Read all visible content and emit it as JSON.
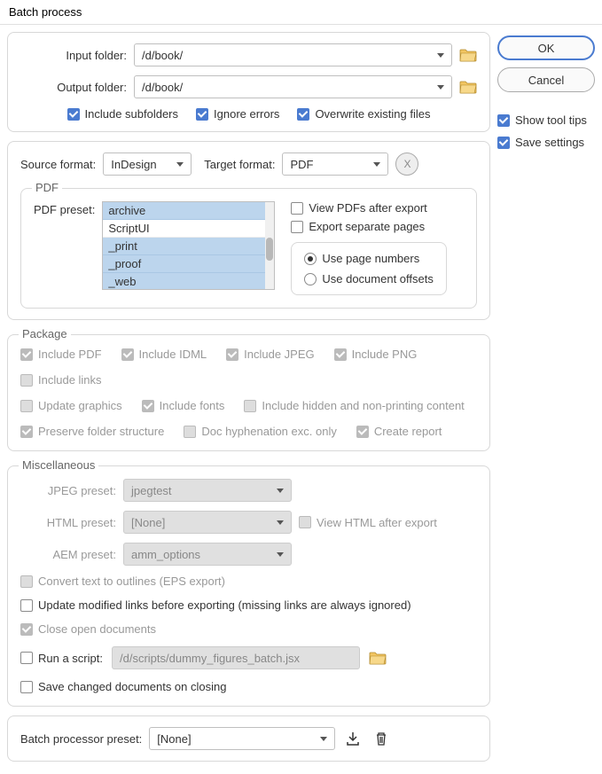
{
  "title": "Batch process",
  "buttons": {
    "ok": "OK",
    "cancel": "Cancel",
    "x": "X"
  },
  "side": {
    "tooltips": "Show tool tips",
    "save": "Save settings"
  },
  "io": {
    "input_label": "Input folder:",
    "input_value": "/d/book/",
    "output_label": "Output folder:",
    "output_value": "/d/book/",
    "subfolders": "Include subfolders",
    "ignore": "Ignore errors",
    "overwrite": "Overwrite existing files"
  },
  "format": {
    "source_label": "Source format:",
    "source_value": "InDesign",
    "target_label": "Target format:",
    "target_value": "PDF"
  },
  "pdf": {
    "legend": "PDF",
    "preset_label": "PDF preset:",
    "items": {
      "a": "archive",
      "b": "ScriptUI",
      "c": "_print",
      "d": "_proof",
      "e": "_web"
    },
    "view": "View PDFs after export",
    "separate": "Export separate pages",
    "pagenum": "Use page numbers",
    "offsets": "Use document offsets"
  },
  "pkg": {
    "legend": "Package",
    "pdf": "Include PDF",
    "idml": "Include IDML",
    "jpeg": "Include JPEG",
    "png": "Include PNG",
    "links": "Include links",
    "update": "Update graphics",
    "fonts": "Include fonts",
    "hidden": "Include hidden and non-printing content",
    "preserve": "Preserve folder structure",
    "hyph": "Doc hyphenation exc. only",
    "report": "Create report"
  },
  "misc": {
    "legend": "Miscellaneous",
    "jpeg_label": "JPEG preset:",
    "jpeg_value": "jpegtest",
    "html_label": "HTML preset:",
    "html_value": "[None]",
    "view_html": "View HTML after export",
    "aem_label": "AEM preset:",
    "aem_value": "amm_options",
    "eps": "Convert text to outlines (EPS export)",
    "links": "Update modified links before exporting (missing links are always ignored)",
    "close": "Close open documents",
    "script_label": "Run a script:",
    "script_value": "/d/scripts/dummy_figures_batch.jsx",
    "save_changed": "Save changed documents on closing"
  },
  "batch": {
    "label": "Batch processor preset:",
    "value": "[None]"
  }
}
